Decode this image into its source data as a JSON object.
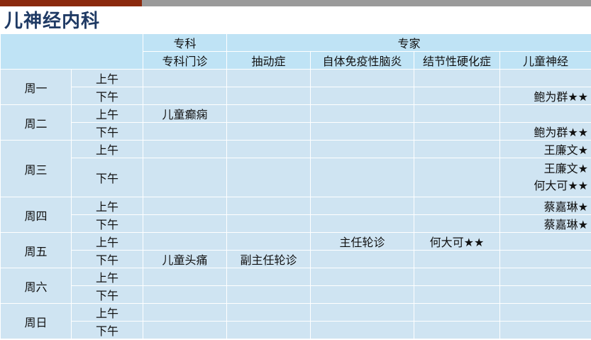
{
  "colors": {
    "bar_left": "#8b2a0e",
    "bar_right": "#9a9a9a",
    "title": "#1f3a64"
  },
  "title": "儿神经内科",
  "header": {
    "group1": "专科",
    "group2": "专家",
    "sub": [
      "专科门诊",
      "抽动症",
      "自体免疫性脑炎",
      "结节性硬化症",
      "儿童神经"
    ]
  },
  "days": [
    {
      "name": "周一",
      "am": {
        "label": "上午",
        "c1": "",
        "c2": "",
        "c3": "",
        "c4": "",
        "c5": ""
      },
      "pm": {
        "label": "下午",
        "c1": "",
        "c2": "",
        "c3": "",
        "c4": "",
        "c5": "鲍为群★★"
      }
    },
    {
      "name": "周二",
      "am": {
        "label": "上午",
        "c1": "儿童癫痫",
        "c2": "",
        "c3": "",
        "c4": "",
        "c5": ""
      },
      "pm": {
        "label": "下午",
        "c1": "",
        "c2": "",
        "c3": "",
        "c4": "",
        "c5": "鲍为群★★"
      }
    },
    {
      "name": "周三",
      "am": {
        "label": "上午",
        "c1": "",
        "c2": "",
        "c3": "",
        "c4": "",
        "c5": "王廉文★"
      },
      "pm": {
        "label": "下午",
        "c1": "",
        "c2": "",
        "c3": "",
        "c4": "",
        "c5a": "王廉文★",
        "c5b": "何大可★★"
      }
    },
    {
      "name": "周四",
      "am": {
        "label": "上午",
        "c1": "",
        "c2": "",
        "c3": "",
        "c4": "",
        "c5": "蔡嘉琳★"
      },
      "pm": {
        "label": "下午",
        "c1": "",
        "c2": "",
        "c3": "",
        "c4": "",
        "c5": "蔡嘉琳★"
      }
    },
    {
      "name": "周五",
      "am": {
        "label": "上午",
        "c1": "",
        "c2": "",
        "c3": "主任轮诊",
        "c4": "何大可★★",
        "c5": ""
      },
      "pm": {
        "label": "下午",
        "c1": "儿童头痛",
        "c2": "副主任轮诊",
        "c3": "",
        "c4": "",
        "c5": ""
      }
    },
    {
      "name": "周六",
      "am": {
        "label": "上午",
        "c1": "",
        "c2": "",
        "c3": "",
        "c4": "",
        "c5": ""
      },
      "pm": {
        "label": "下午",
        "c1": "",
        "c2": "",
        "c3": "",
        "c4": "",
        "c5": ""
      }
    },
    {
      "name": "周日",
      "am": {
        "label": "上午",
        "c1": "",
        "c2": "",
        "c3": "",
        "c4": "",
        "c5": ""
      },
      "pm": {
        "label": "下午",
        "c1": "",
        "c2": "",
        "c3": "",
        "c4": "",
        "c5": ""
      }
    }
  ]
}
